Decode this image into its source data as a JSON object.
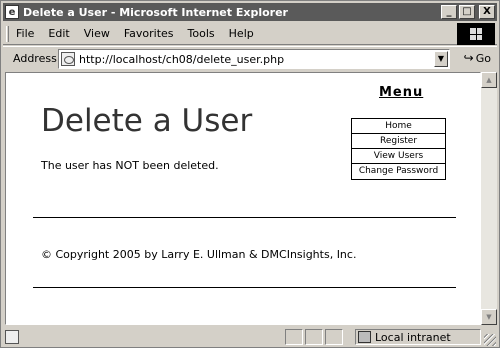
{
  "window": {
    "title": "Delete a User - Microsoft Internet Explorer",
    "controls": {
      "minimize": "_",
      "maximize": "□",
      "close": "X"
    }
  },
  "menubar": {
    "items": [
      "File",
      "Edit",
      "View",
      "Favorites",
      "Tools",
      "Help"
    ]
  },
  "addressbar": {
    "label": "Address",
    "url": "http://localhost/ch08/delete_user.php",
    "go_label": "Go"
  },
  "page": {
    "menu_title": "Menu",
    "nav": [
      "Home",
      "Register",
      "View Users",
      "Change Password"
    ],
    "heading": "Delete a User",
    "message": "The user has NOT been deleted.",
    "copyright": "© Copyright 2005 by Larry E. Ullman & DMCInsights, Inc."
  },
  "statusbar": {
    "zone": "Local intranet"
  },
  "icons": {
    "title": "ie-page-icon",
    "address": "page-icon",
    "go": "go-arrow-icon",
    "zone": "intranet-icon"
  }
}
